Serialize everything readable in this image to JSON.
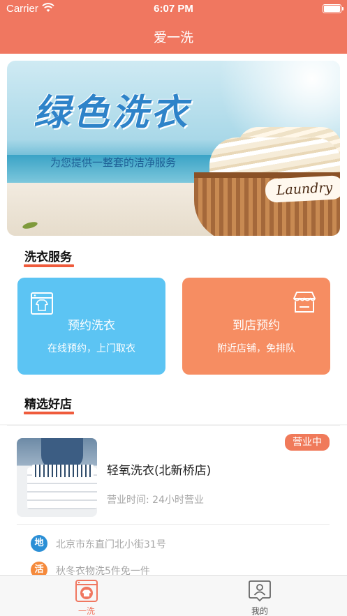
{
  "status_bar": {
    "carrier": "Carrier",
    "time": "6:07 PM"
  },
  "nav": {
    "title": "爱一洗"
  },
  "banner": {
    "title": "绿色洗衣",
    "subtitle": "为您提供一整套的洁净服务",
    "label": "Laundry"
  },
  "services": {
    "heading": "洗衣服务",
    "cards": [
      {
        "title": "预约洗衣",
        "subtitle": "在线预约，上门取衣",
        "icon": "washing-machine-icon",
        "color": "#5cc4f3"
      },
      {
        "title": "到店预约",
        "subtitle": "附近店铺，免排队",
        "icon": "storefront-icon",
        "color": "#f68d62"
      }
    ]
  },
  "shops": {
    "heading": "精选好店",
    "items": [
      {
        "badge": "营业中",
        "name": "轻氧洗衣(北新桥店)",
        "hours": "营业时间:  24小时营业",
        "address_icon_text": "地",
        "address": "北京市东直门北小街31号",
        "promo_icon_text": "活",
        "promo": "秋冬衣物洗5件免一件"
      }
    ]
  },
  "tabbar": {
    "tabs": [
      {
        "label": "一洗",
        "icon": "laundry-tab-icon",
        "active": true
      },
      {
        "label": "我的",
        "icon": "profile-tab-icon",
        "active": false
      }
    ],
    "active_color": "#f07760",
    "inactive_color": "#555555"
  },
  "colors": {
    "header": "#f07760",
    "accent_underline": "#ef5b3c",
    "address_icon": "#2b8fd6",
    "promo_icon": "#f58a3c"
  }
}
